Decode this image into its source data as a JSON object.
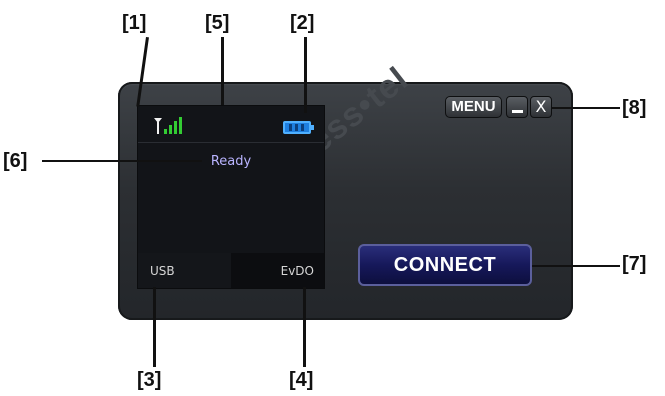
{
  "callouts": {
    "c1": "[1]",
    "c2": "[2]",
    "c3": "[3]",
    "c4": "[4]",
    "c5": "[5]",
    "c6": "[6]",
    "c7": "[7]",
    "c8": "[8]"
  },
  "watermark": "axess•tel",
  "screen": {
    "status": "Ready",
    "connection_type": "USB",
    "network": "EvDO",
    "signal_icon": "signal-strength-icon",
    "battery_icon": "battery-icon"
  },
  "controls": {
    "menu_label": "MENU",
    "minimize_label": "_",
    "close_label": "X",
    "connect_label": "CONNECT"
  },
  "colors": {
    "status_text": "#b9b4ff",
    "battery": "#1e7fe0",
    "connect_bg": "#16185a"
  }
}
